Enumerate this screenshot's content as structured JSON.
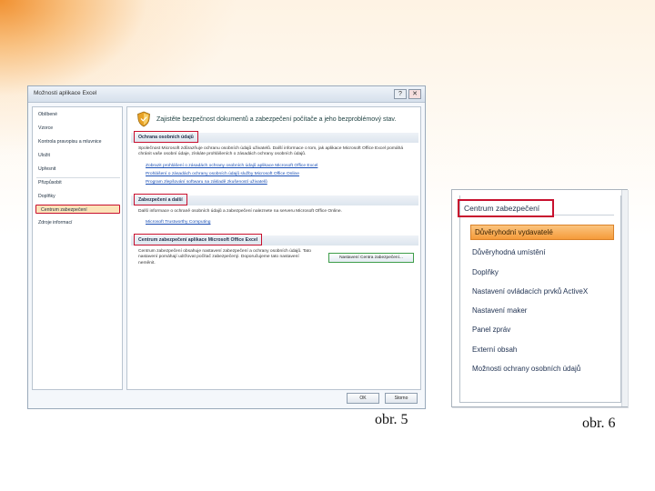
{
  "dialog": {
    "title": "Možnosti aplikace Excel",
    "help_glyph": "?",
    "close_glyph": "✕",
    "nav": [
      "Oblíbené",
      "Vzorce",
      "Kontrola pravopisu a mluvnice",
      "Uložit",
      "Upřesnit",
      "Přizpůsobit",
      "Doplňky",
      "Centrum zabezpečení",
      "Zdroje informací"
    ],
    "nav_selected_index": 7,
    "headline": "Zajistěte bezpečnost dokumentů a zabezpečení počítače a jeho bezproblémový stav.",
    "privacy": {
      "title": "Ochrana osobních údajů",
      "text": "Společnost Microsoft zdůrazňuje ochranu osobních údajů uživatelů. Další informace o tom, jak aplikace Microsoft Office Excel pomáhá chránit vaše osobní údaje, získáte prohlášeních o zásadách ochrany osobních údajů.",
      "links": [
        "Zobrazit prohlášení o zásadách ochrany osobních údajů aplikace Microsoft Office Excel",
        "Prohlášení o zásadách ochrany osobních údajů služby Microsoft Office Online",
        "Program zlepšování softwaru na základě zkušeností uživatelů"
      ]
    },
    "security": {
      "title": "Zabezpečení a další",
      "text": "Další informace o ochraně osobních údajů a zabezpečení naleznete na serveru Microsoft Office Online.",
      "link": "Microsoft Trustworthy Computing"
    },
    "trust": {
      "title": "Centrum zabezpečení aplikace Microsoft Office Excel",
      "text": "Centrum zabezpečení obsahuje nastavení zabezpečení a ochrany osobních údajů. Tato nastavení pomáhají udržovat počítač zabezpečený. Doporučujeme tato nastavení neměnit.",
      "button": "Nastavení Centra zabezpečení..."
    },
    "ok": "OK",
    "cancel": "Storno"
  },
  "panel": {
    "title": "Centrum zabezpečení",
    "items": [
      "Důvěryhodní vydavatelé",
      "Důvěryhodná umístění",
      "Doplňky",
      "Nastavení ovládacích prvků ActiveX",
      "Nastavení maker",
      "Panel zpráv",
      "Externí obsah",
      "Možnosti ochrany osobních údajů"
    ],
    "selected_index": 0
  },
  "captions": {
    "fig5": "obr. 5",
    "fig6": "obr. 6"
  },
  "colors": {
    "highlight_border": "#c8102e",
    "selected_fill": "#f59b3a",
    "link": "#1a4fb5",
    "shield_icon": "#e8a125"
  }
}
